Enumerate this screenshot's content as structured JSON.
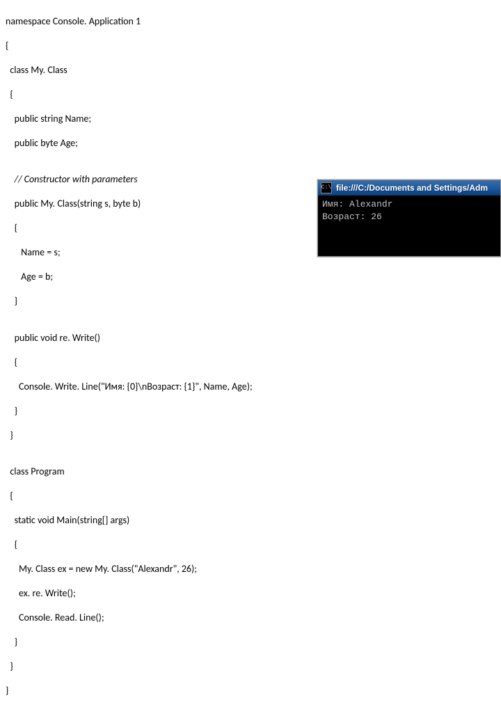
{
  "code": {
    "l01": "namespace Console. Application 1",
    "l02": "{",
    "l03": "  class My. Class",
    "l04": "  {",
    "l05": "    public string Name;",
    "l06": "    public byte Age;",
    "l07": "",
    "l08": "    // Constructor with parameters",
    "l09": "    public My. Class(string s, byte b)",
    "l10": "    {",
    "l11": "       Name = s;",
    "l12": "       Age = b;",
    "l13": "    }",
    "l14": "",
    "l15": "    public void re. Write()",
    "l16": "    {",
    "l17": "      Console. Write. Line(\"Имя: {0}\\nВозраст: {1}\", Name, Age);",
    "l18": "    }",
    "l19": "  }",
    "l20": "",
    "l21": "  class Program",
    "l22": "  {",
    "l23": "    static void Main(string[] args)",
    "l24": "    {",
    "l25": "      My. Class ex = new My. Class(\"Alexandr\", 26);",
    "l26": "      ex. re. Write();",
    "l27": "      Console. Read. Line();",
    "l28": "    }",
    "l29": "  }",
    "l30": "}"
  },
  "console": {
    "icon_text": "C:\\",
    "title": "file:///C:/Documents and Settings/Adm",
    "line1": "Имя: Alexandr",
    "line2": "Возраст: 26"
  }
}
